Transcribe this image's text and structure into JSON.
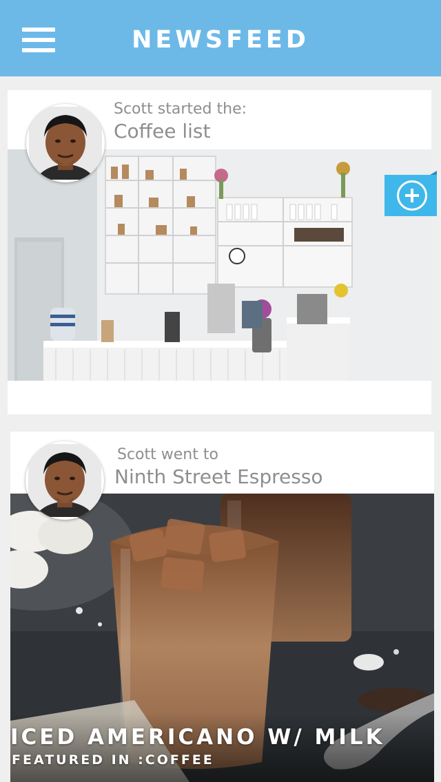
{
  "header": {
    "title": "NEWSFEED",
    "menu_icon": "hamburger-menu-icon",
    "background": "#6cb9e8"
  },
  "feed": [
    {
      "line1": "Scott started the:",
      "line2": "Coffee list",
      "avatar": "user-avatar",
      "image": "coffee-shop-interior-photo",
      "action_icon": "plus-circle-icon",
      "action_color": "#3fb7ea"
    },
    {
      "line1": "Scott went to",
      "line2": "Ninth Street Espresso",
      "avatar": "user-avatar",
      "image": "iced-coffee-photo",
      "caption_title": "ICED AMERICANO W/ MILK",
      "caption_sub": "FEATURED IN :COFFEE"
    }
  ]
}
